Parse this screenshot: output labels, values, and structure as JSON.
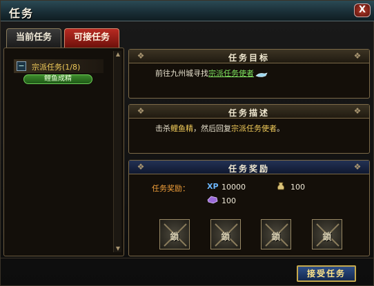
{
  "window": {
    "title": "任务",
    "close_label": "X"
  },
  "tabs": [
    {
      "label": "当前任务",
      "active": false
    },
    {
      "label": "可接任务",
      "active": true
    }
  ],
  "quest_list": {
    "group_toggle": "−",
    "group_label": "宗派任务(1/8)",
    "items": [
      {
        "label": "鲤鱼成精"
      }
    ]
  },
  "objective": {
    "title": "任务目标",
    "prefix": "前往",
    "place": "九州城",
    "mid": "寻找",
    "npc": "宗派任务使者",
    "fly_icon": "fly-shoe-icon"
  },
  "description": {
    "title": "任务描述",
    "part1": "击杀",
    "target": "鲤鱼精",
    "part2": "，然后回复",
    "npc": "宗派任务使者",
    "part3": "。"
  },
  "reward": {
    "title": "任务奖励",
    "label": "任务奖励：",
    "xp_icon": "XP",
    "xp_value": "10000",
    "bag_icon": "money-bag-icon",
    "bag_value": "100",
    "gem_icon": "crystal-icon",
    "gem_value": "100",
    "slots": [
      {
        "text": "鎖"
      },
      {
        "text": "鎖"
      },
      {
        "text": "鎖"
      },
      {
        "text": "鎖"
      }
    ]
  },
  "accept_button": {
    "label": "接受任务"
  },
  "colors": {
    "accent_gold": "#c6a94c",
    "npc_green": "#7fe35f",
    "highlight_yellow": "#f2cc5a",
    "reward_orange": "#f2a03a"
  }
}
